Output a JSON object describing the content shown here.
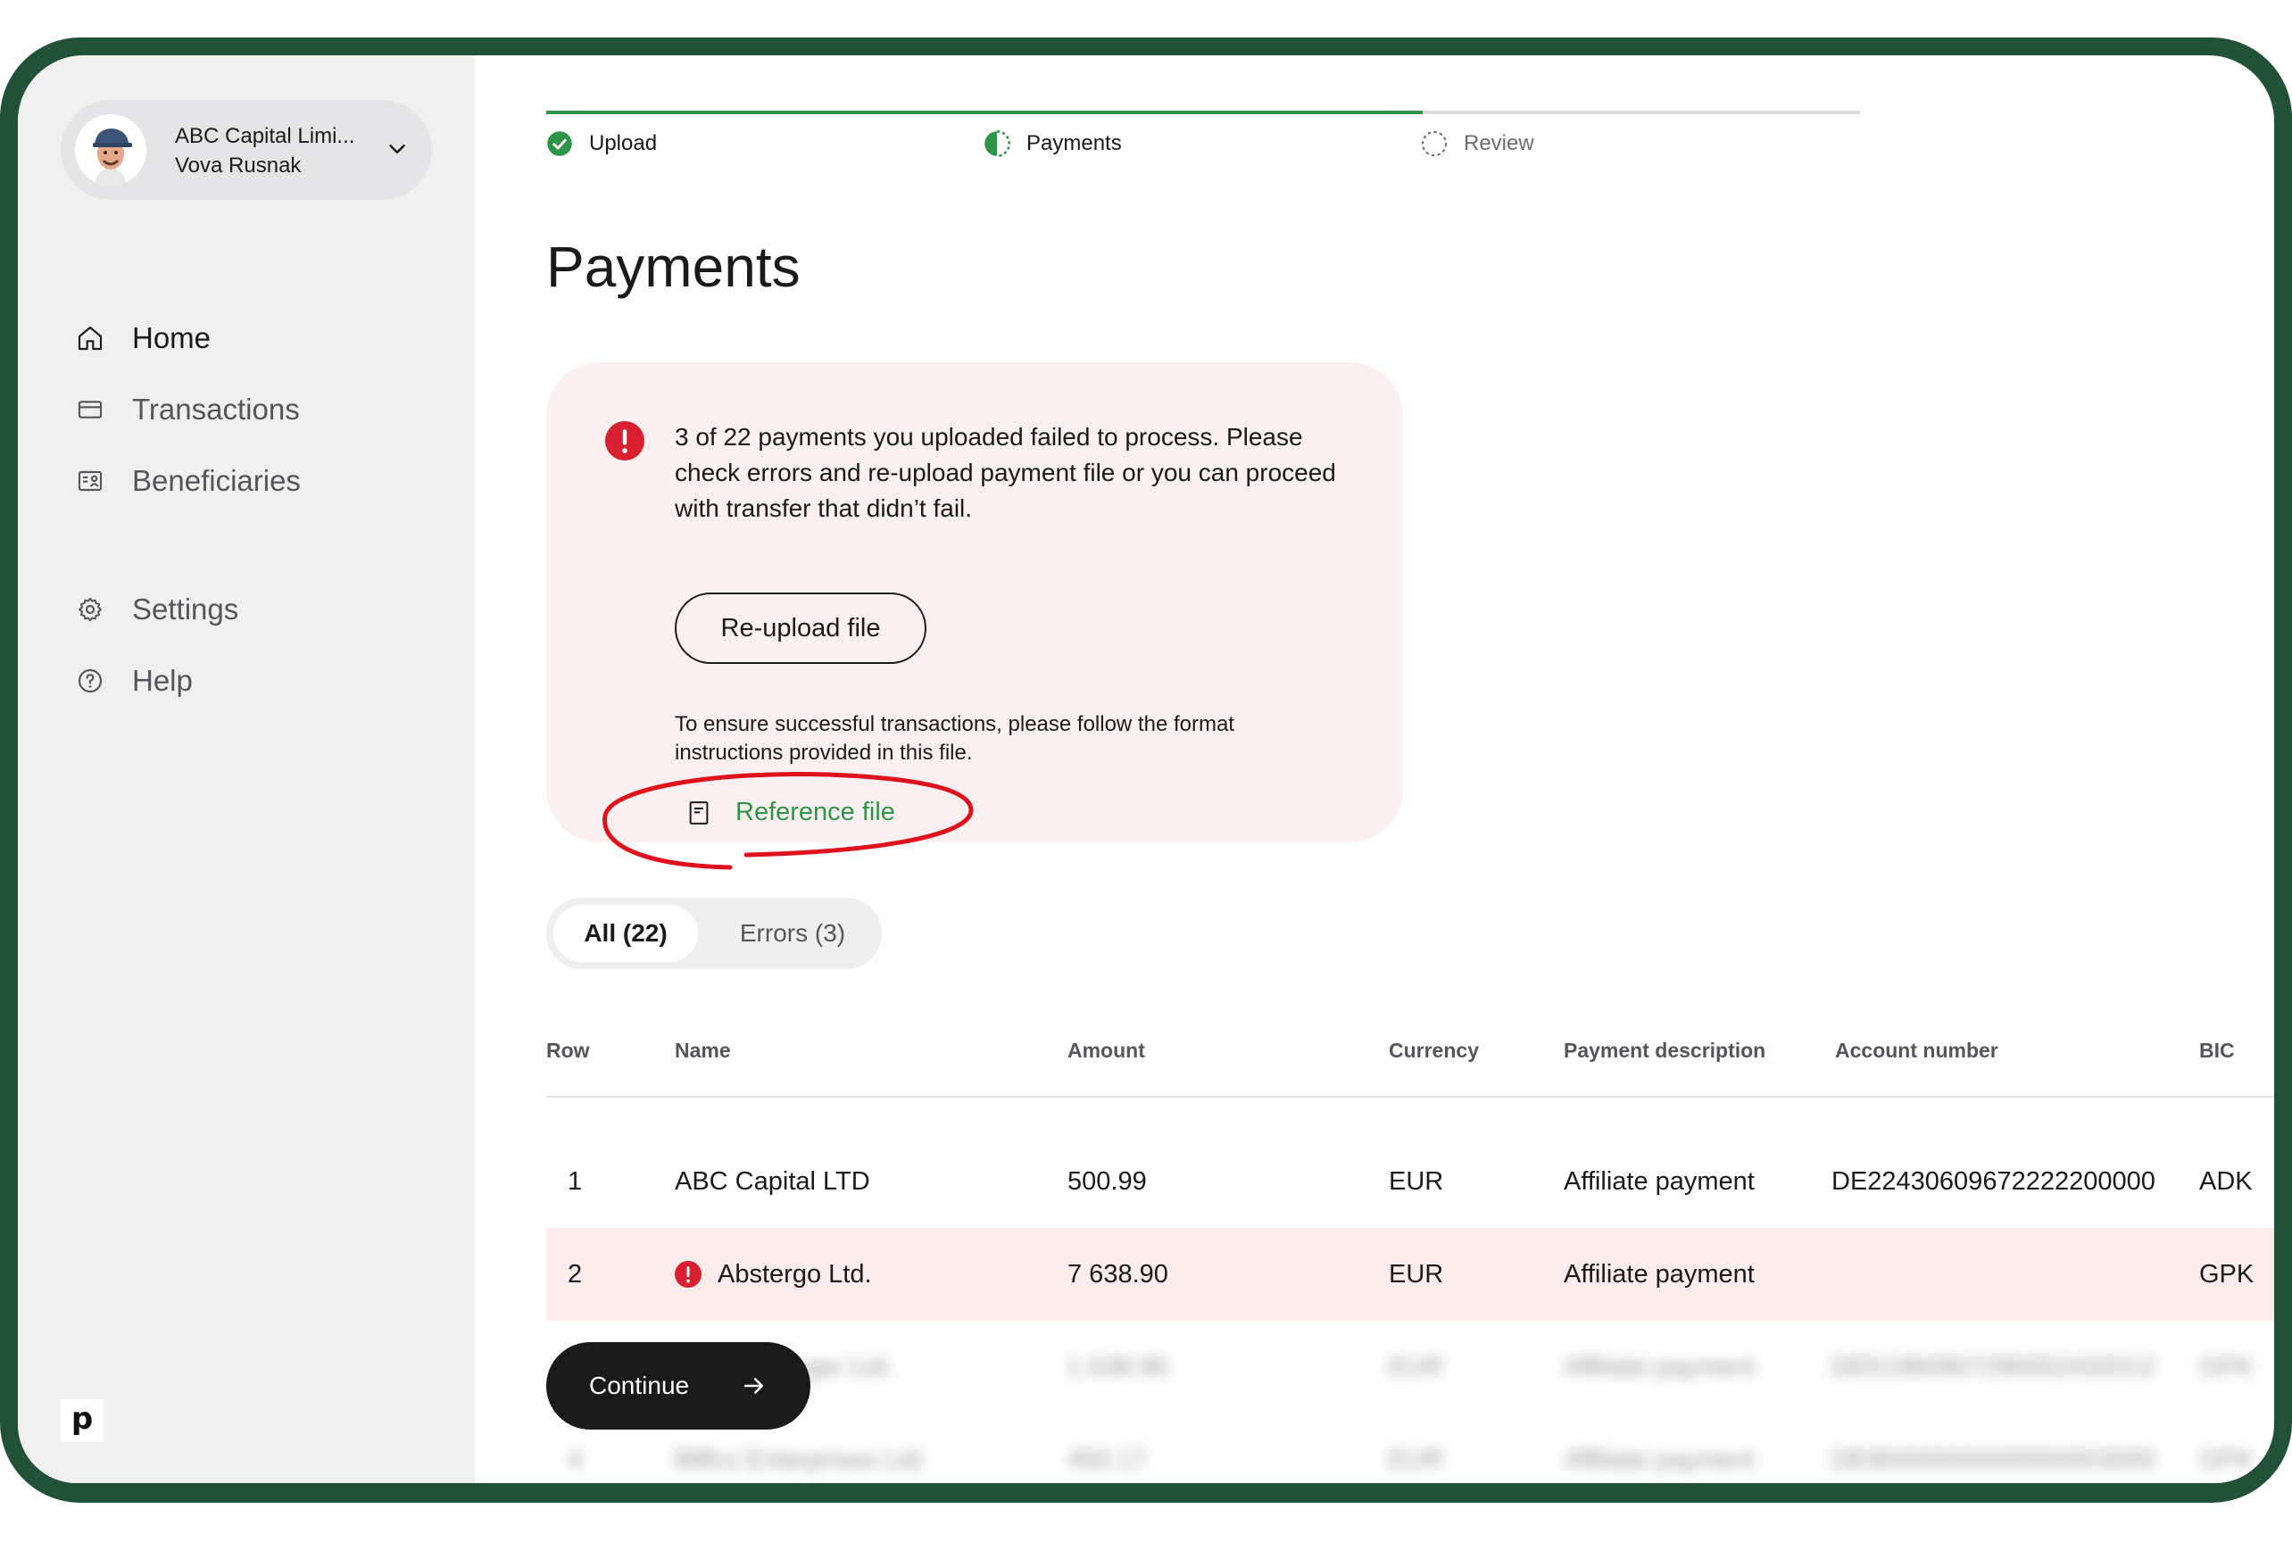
{
  "account": {
    "company": "ABC Capital Limi...",
    "user": "Vova Rusnak"
  },
  "nav": {
    "home": "Home",
    "transactions": "Transactions",
    "beneficiaries": "Beneficiaries",
    "settings": "Settings",
    "help": "Help"
  },
  "logo": "p",
  "stepper": {
    "steps": [
      {
        "label": "Upload",
        "state": "complete"
      },
      {
        "label": "Payments",
        "state": "in-progress"
      },
      {
        "label": "Review",
        "state": "pending"
      }
    ],
    "progress_color": "#2e9448"
  },
  "page": {
    "title": "Payments"
  },
  "alert": {
    "message": "3 of 22 payments you uploaded failed to process. Please check errors and re-upload payment file or you can proceed with transfer that didn’t fail.",
    "reupload_label": "Re-upload file",
    "format_note": "To ensure successful transactions, please follow the format instructions provided in this file.",
    "reference_label": "Reference file",
    "error_color": "#d92030",
    "link_color": "#2e9448"
  },
  "tabs": {
    "all": "All (22)",
    "errors": "Errors (3)"
  },
  "table": {
    "columns": [
      "Row",
      "Name",
      "Amount",
      "Currency",
      "Payment description",
      "Account number",
      "BIC"
    ],
    "rows": [
      {
        "row": "1",
        "name": "ABC Capital LTD",
        "amount": "500.99",
        "currency": "EUR",
        "description": "Affiliate payment",
        "account": "DE22430609672222200000",
        "bic": "ADK",
        "error": false
      },
      {
        "row": "2",
        "name": "Abstergo Ltd.",
        "amount": "7 638.90",
        "currency": "EUR",
        "description": "Affiliate payment",
        "account": "",
        "bic": "GPK",
        "error": true
      },
      {
        "row": "3",
        "name": "Barone Burger Ltd.",
        "amount": "1 638.90",
        "currency": "EUR",
        "description": "Affiliate payment",
        "account": "DE51960907290052432012",
        "bic": "GPK",
        "error": false
      },
      {
        "row": "4",
        "name": "Biffco Enterprises Ltd.",
        "amount": "450.17",
        "currency": "EUR",
        "description": "Affiliate payment",
        "account": "DE90000000000000003000",
        "bic": "GPK",
        "error": false
      }
    ]
  },
  "continue_label": "Continue"
}
